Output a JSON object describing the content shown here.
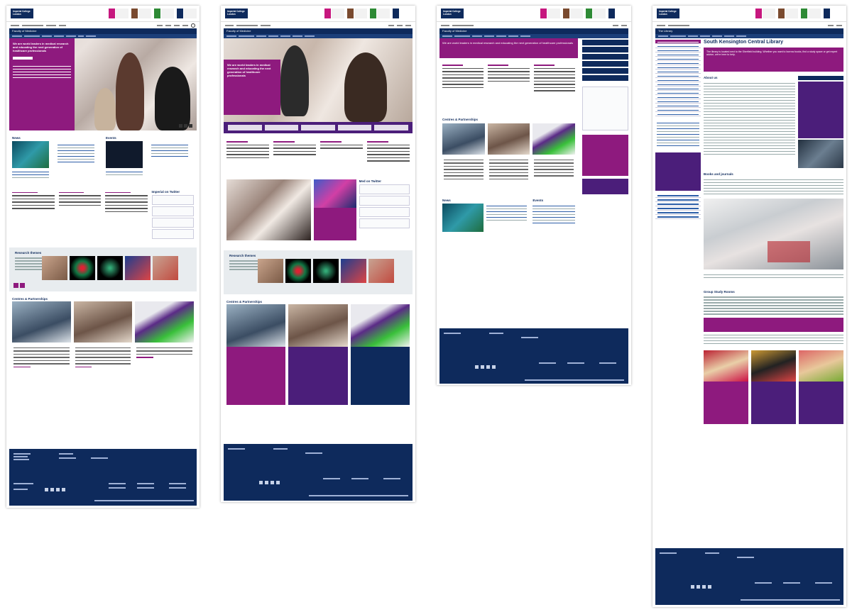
{
  "brand": {
    "logo_text": "Imperial College London"
  },
  "colors": {
    "navy": "#0e2a5c",
    "magenta": "#8e1a7e",
    "violet": "#4b1e7a",
    "link_blue": "#2d5ea8"
  },
  "pages": [
    {
      "site_title": "Faculty of Medicine",
      "hero_text": "We are world leaders in medical research and educating the next generation of healthcare professionals",
      "sections": {
        "news": "News",
        "events": "Events",
        "twitter": "Imperial on Twitter",
        "research_themes": "Research themes",
        "centres": "Centres & Partnerships"
      }
    },
    {
      "site_title": "Faculty of Medicine",
      "hero_text": "We are world leaders in medical research and educating the next generation of healthcare professionals",
      "sections": {
        "twitter": "Med on Twitter",
        "research_themes": "Research themes",
        "centres": "Centres & Partnerships"
      }
    },
    {
      "site_title": "Faculty of Medicine",
      "hero_text": "We are world leaders in medical research and educating the next generation of healthcare professionals",
      "sections": {
        "centres": "Centres & Partnerships",
        "news": "News",
        "events": "Events"
      }
    },
    {
      "site_title": "The Library",
      "page_title": "South Kensington Central Library",
      "intro_text": "The library is located next to the Sherfield building. Whether you want to borrow books, find a study space or get expert advice, we're here to help.",
      "sections": {
        "about": "About us",
        "books": "Books and journals",
        "group_study": "Group Study Rooms"
      }
    }
  ]
}
